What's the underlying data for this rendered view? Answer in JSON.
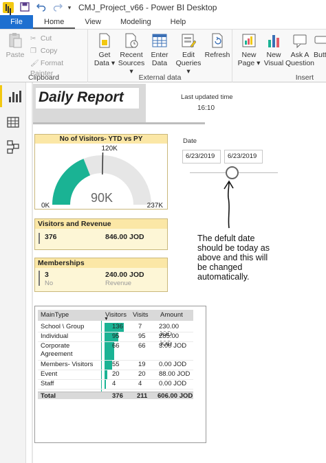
{
  "window": {
    "title": "CMJ_Project_v66 - Power BI Desktop"
  },
  "tabs": [
    {
      "label": "File"
    },
    {
      "label": "Home"
    },
    {
      "label": "View"
    },
    {
      "label": "Modeling"
    },
    {
      "label": "Help"
    }
  ],
  "ribbon": {
    "clipboard": {
      "label": "Clipboard",
      "paste": "Paste",
      "cut": "Cut",
      "copy": "Copy",
      "format_painter": "Format Painter"
    },
    "external_data": {
      "label": "External data",
      "get_data": [
        "Get",
        "Data ▾"
      ],
      "recent_sources": [
        "Recent",
        "Sources ▾"
      ],
      "enter_data": [
        "Enter",
        "Data"
      ],
      "edit_queries": [
        "Edit",
        "Queries ▾"
      ],
      "refresh": "Refresh"
    },
    "insert": {
      "label": "Insert",
      "new_page": [
        "New",
        "Page ▾"
      ],
      "new_visual": [
        "New",
        "Visual"
      ],
      "ask_question": [
        "Ask A",
        "Question"
      ],
      "buttons": "Butt"
    }
  },
  "report": {
    "title": "Daily Report",
    "last_updated_label": "Last updated time",
    "last_updated_time": "16:10"
  },
  "gauge": {
    "title": "No of Visitors- YTD vs PY",
    "value": 90,
    "value_label": "90K",
    "min": 0,
    "max": 237,
    "min_label": "0K",
    "max_label": "237K",
    "target": 120,
    "target_label": "120K",
    "fill_color": "#1ab394"
  },
  "kpi_visitors": {
    "title": "Visitors and Revenue",
    "value1": "376",
    "value2": "846.00 JOD"
  },
  "kpi_memberships": {
    "title": "Memberships",
    "value1": "3",
    "value2": "240.00 JOD",
    "sub1": "No",
    "sub2": "Revenue"
  },
  "slicer": {
    "label": "Date",
    "start": "6/23/2019",
    "end": "6/23/2019"
  },
  "annotation": "The defult date should be today as above and this will be changed automatically.",
  "table": {
    "headers": {
      "type": "MainType",
      "visitors": "Visitors",
      "visits": "Visits",
      "amount": "Amount"
    },
    "bar_max": 136,
    "rows": [
      {
        "type": "School \\ Group",
        "type2": "",
        "visitors": 136,
        "visitors_label": "136",
        "visits": "7",
        "amount": "230.00 JOD"
      },
      {
        "type": "Individual",
        "type2": "",
        "visitors": 95,
        "visitors_label": "95",
        "visits": "95",
        "amount": "285.00 JOD"
      },
      {
        "type": "Corporate",
        "type2": "Agreement",
        "visitors": 66,
        "visitors_label": "66",
        "visits": "66",
        "amount": "3.00 JOD"
      },
      {
        "type": "Members- Visitors",
        "type2": "",
        "visitors": 55,
        "visitors_label": "55",
        "visits": "19",
        "amount": "0.00 JOD"
      },
      {
        "type": "Event",
        "type2": "",
        "visitors": 20,
        "visitors_label": "20",
        "visits": "20",
        "amount": "88.00 JOD"
      },
      {
        "type": "Staff",
        "type2": "",
        "visitors": 4,
        "visitors_label": "4",
        "visits": "4",
        "amount": "0.00 JOD"
      }
    ],
    "total": {
      "type": "Total",
      "visitors": "376",
      "visits": "211",
      "amount": "606.00 JOD"
    }
  }
}
